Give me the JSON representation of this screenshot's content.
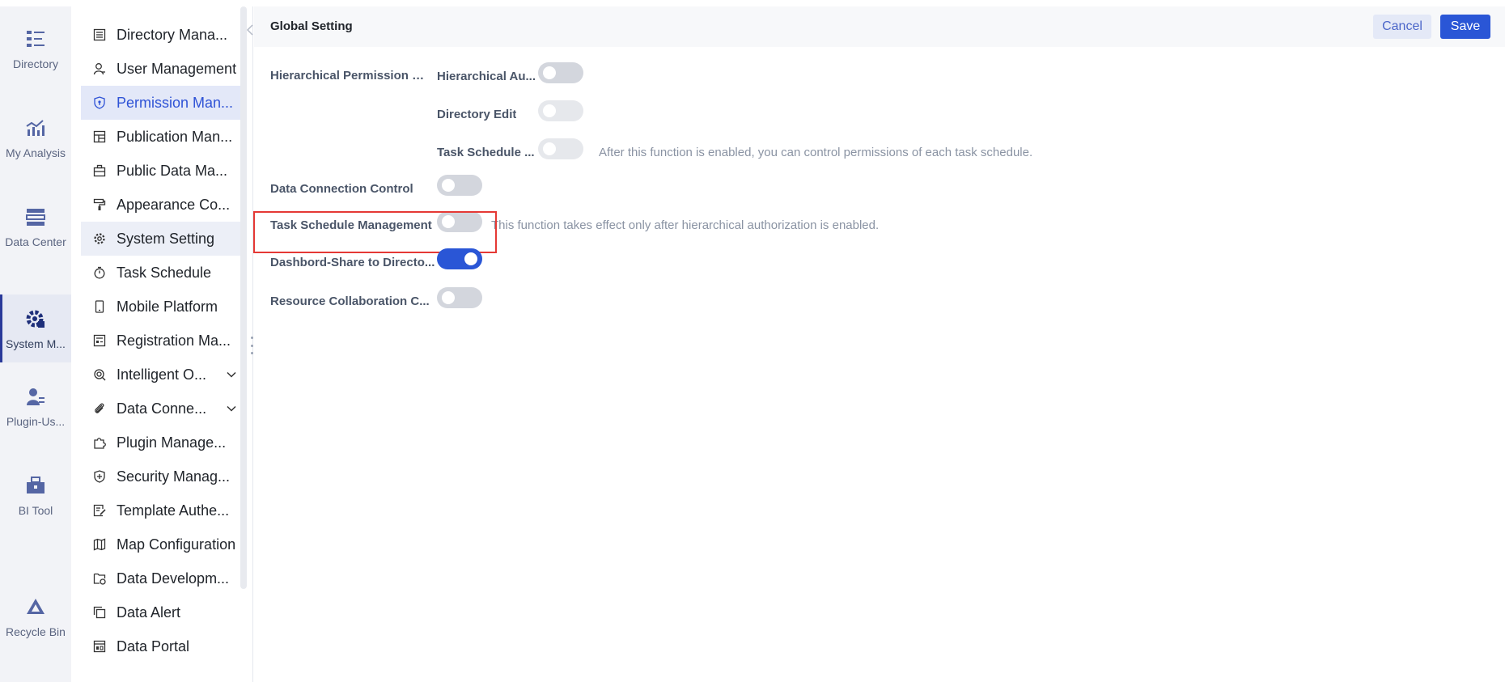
{
  "rail": {
    "items": [
      {
        "label": "Directory",
        "icon": "directory-icon"
      },
      {
        "label": "My Analysis",
        "icon": "analysis-icon"
      },
      {
        "label": "Data Center",
        "icon": "data-center-icon"
      },
      {
        "label": "System M...",
        "icon": "system-gear-icon"
      },
      {
        "label": "Plugin-Us...",
        "icon": "plugin-user-icon"
      },
      {
        "label": "BI Tool",
        "icon": "toolbox-icon"
      },
      {
        "label": "Recycle Bin",
        "icon": "recycle-bin-icon"
      }
    ],
    "active_index": 3
  },
  "menu": {
    "items": [
      {
        "label": "Directory Mana...",
        "icon": "directory-list-icon"
      },
      {
        "label": "User Management",
        "icon": "user-icon"
      },
      {
        "label": "Permission Man...",
        "icon": "shield-icon"
      },
      {
        "label": "Publication Man...",
        "icon": "layout-icon"
      },
      {
        "label": "Public Data Ma...",
        "icon": "briefcase-icon"
      },
      {
        "label": "Appearance Co...",
        "icon": "paint-roller-icon"
      },
      {
        "label": "System Setting",
        "icon": "gear-icon"
      },
      {
        "label": "Task Schedule",
        "icon": "stopwatch-icon"
      },
      {
        "label": "Mobile Platform",
        "icon": "mobile-icon"
      },
      {
        "label": "Registration Ma...",
        "icon": "registration-icon"
      },
      {
        "label": "Intelligent O...",
        "icon": "intelligent-ops-icon",
        "expandable": true
      },
      {
        "label": "Data Conne...",
        "icon": "paperclip-icon",
        "expandable": true
      },
      {
        "label": "Plugin Manage...",
        "icon": "puzzle-icon"
      },
      {
        "label": "Security Manag...",
        "icon": "security-shield-icon"
      },
      {
        "label": "Template Authe...",
        "icon": "template-edit-icon"
      },
      {
        "label": "Map Configuration",
        "icon": "map-icon"
      },
      {
        "label": "Data Developm...",
        "icon": "data-dev-icon"
      },
      {
        "label": "Data Alert",
        "icon": "alert-copy-icon"
      },
      {
        "label": "Data Portal",
        "icon": "portal-icon"
      }
    ],
    "selected_index": 2,
    "hover_index": 6
  },
  "header": {
    "title": "Global Setting",
    "cancel_label": "Cancel",
    "save_label": "Save"
  },
  "settings": {
    "hierarchical_permission": {
      "label": "Hierarchical Permission M...",
      "sub": [
        {
          "label": "Hierarchical Au...",
          "on": false,
          "disabled": false
        },
        {
          "label": "Directory Edit",
          "on": false,
          "disabled": true
        },
        {
          "label": "Task Schedule ...",
          "on": false,
          "disabled": true,
          "hint": "After this function is enabled, you can control permissions of each task schedule."
        }
      ]
    },
    "data_connection_control": {
      "label": "Data Connection Control",
      "on": false
    },
    "task_schedule_management": {
      "label": "Task Schedule Management",
      "on": false,
      "hint": "This function takes effect only after hierarchical authorization is enabled."
    },
    "dashboard_share": {
      "label": "Dashbord-Share to Directo...",
      "on": true
    },
    "resource_collaboration": {
      "label": "Resource Collaboration C...",
      "on": false
    }
  },
  "colors": {
    "accent": "#2a56d6",
    "highlight": "#e53935"
  }
}
